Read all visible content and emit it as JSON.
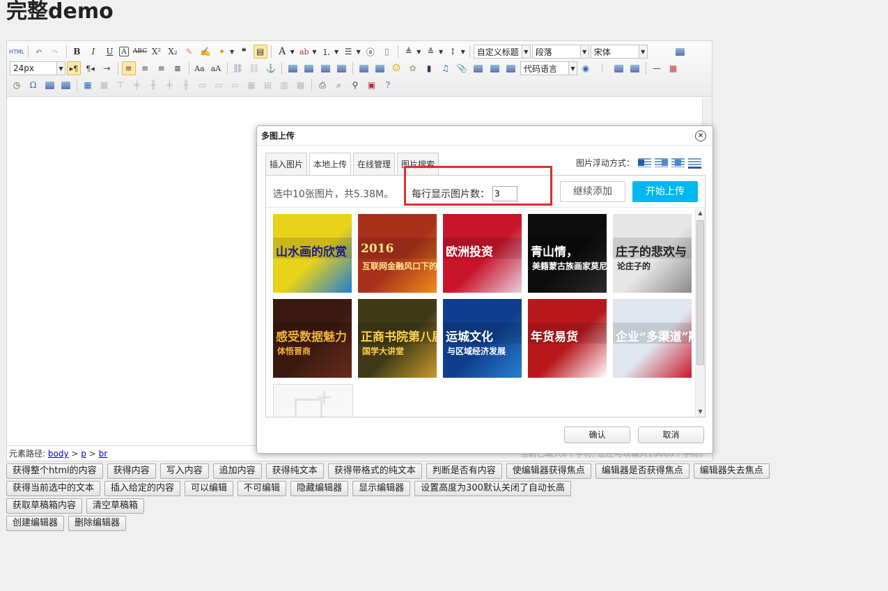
{
  "page": {
    "title": "完整demo"
  },
  "toolbar": {
    "html_label": "HTML",
    "font_size": "24px",
    "heading_style": "自定义标题",
    "paragraph": "段落",
    "font_family": "宋体",
    "code_language": "代码语言"
  },
  "status_bar": {
    "path_label": "元素路径:",
    "path": [
      "body",
      "p",
      "br"
    ],
    "separator": ">",
    "word_count": "当前已输入0个字符, 您还可以输入10000个字符。"
  },
  "dialog": {
    "title": "多图上传",
    "close_icon": "×",
    "tabs": [
      "插入图片",
      "本地上传",
      "在线管理",
      "图片搜索"
    ],
    "active_tab": "本地上传",
    "float_label": "图片浮动方式：",
    "upload": {
      "info": "选中10张图片，共5.38M。",
      "per_row_label": "每行显示图片数：",
      "per_row_value": "3",
      "continue_label": "继续添加",
      "start_label": "开始上传"
    },
    "thumbnails": [
      {
        "top": "山水画的欣赏",
        "sub": "",
        "bg": "#e8d21a",
        "accent": "#1e7dd4",
        "fg": "#1a1a8a"
      },
      {
        "top": "2016",
        "sub": "互联网金融风口下的生存之道",
        "bg": "#a8311c",
        "accent": "#f08c1a",
        "fg": "#ffe48a"
      },
      {
        "top": "欧洲投资",
        "sub": "",
        "bg": "#c8152b",
        "accent": "#e8d0e0",
        "fg": "#ffffff"
      },
      {
        "top": "青山情，",
        "sub": "美籍蒙古族画家莫尼当",
        "bg": "#0c0c0c",
        "accent": "#2a2a2a",
        "fg": "#ffffff"
      },
      {
        "top": "庄子的悲欢与",
        "sub": "论庄子的",
        "bg": "#e6e6e6",
        "accent": "#8a8a8a",
        "fg": "#222222"
      },
      {
        "top": "感受数据魅力",
        "sub": "体悟晋商",
        "bg": "#3a1a10",
        "accent": "#6a2a18",
        "fg": "#f0b03a"
      },
      {
        "top": "正商书院第八届",
        "sub": "国学大讲堂",
        "bg": "#3e3a18",
        "accent": "#c89a2a",
        "fg": "#ffd24a"
      },
      {
        "top": "运城文化",
        "sub": "与区域经济发展",
        "bg": "#0f3f8c",
        "accent": "#2a7fd0",
        "fg": "#ffffff"
      },
      {
        "top": "年货易货",
        "sub": "",
        "bg": "#b8181c",
        "accent": "#ffffff",
        "fg": "#ffffff"
      },
      {
        "top": "企业“多渠道”融资",
        "sub": "",
        "bg": "#dfe6ee",
        "accent": "#c8192b",
        "fg": "#ffffff"
      }
    ],
    "confirm_label": "确认",
    "cancel_label": "取消"
  },
  "buttons": {
    "row1": [
      "获得整个html的内容",
      "获得内容",
      "写入内容",
      "追加内容",
      "获得纯文本",
      "获得带格式的纯文本",
      "判断是否有内容",
      "使编辑器获得焦点",
      "编辑器是否获得焦点",
      "编辑器失去焦点"
    ],
    "row2": [
      "获得当前选中的文本",
      "插入给定的内容",
      "可以编辑",
      "不可编辑",
      "隐藏编辑器",
      "显示编辑器",
      "设置高度为300默认关闭了自动长高"
    ],
    "row3": [
      "获取草稿箱内容",
      "清空草稿箱"
    ],
    "row4": [
      "创建编辑器",
      "删除编辑器"
    ]
  },
  "colors": {
    "accent": "#00b7ee",
    "highlight_box": "#e52b2b",
    "link": "#0000cc"
  }
}
